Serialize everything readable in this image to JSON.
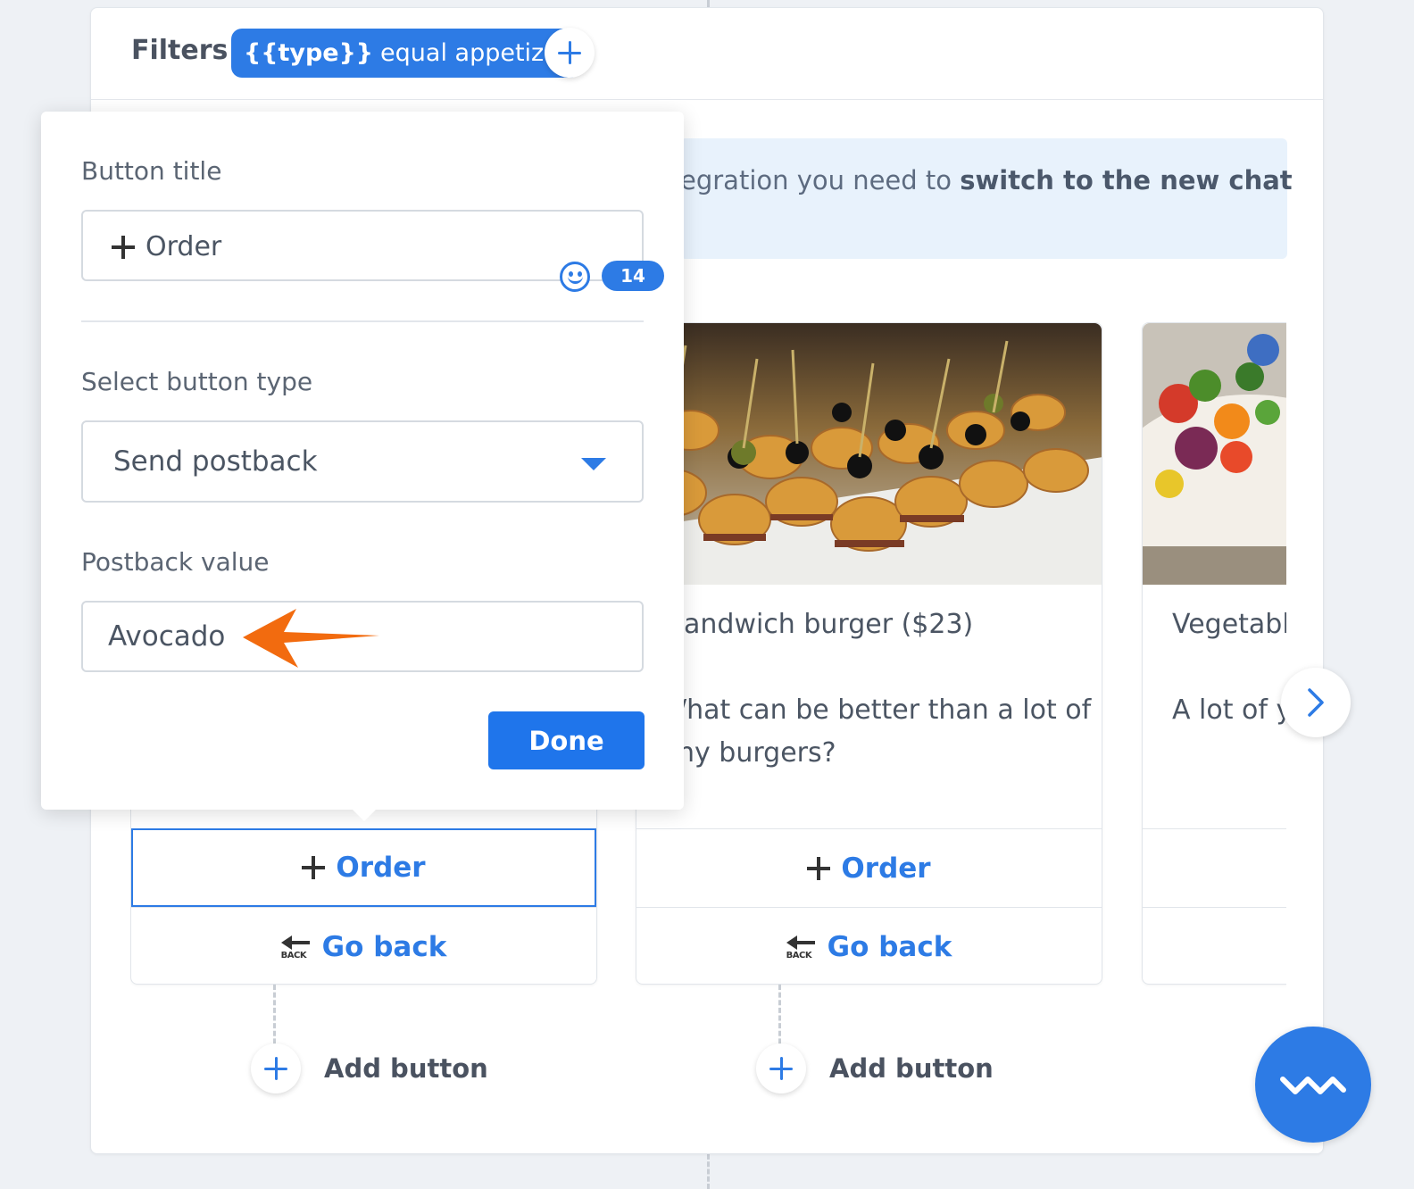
{
  "filters": {
    "label": "Filters",
    "chip_var": "{{type}}",
    "chip_text": "equal appetizer"
  },
  "banner": {
    "text_start": "egration you need to ",
    "text_bold": "switch to the new chat"
  },
  "cards": [
    {
      "title": "",
      "description": [],
      "buttons": [
        {
          "label": "Order",
          "icon": "plus-icon"
        },
        {
          "label": "Go back",
          "icon": "back-icon"
        }
      ],
      "add_button_label": "Add button"
    },
    {
      "title": "andwich burger ($23)",
      "description": [
        "/hat can be better than a lot of",
        "ny burgers?"
      ],
      "buttons": [
        {
          "label": "Order",
          "icon": "plus-icon"
        },
        {
          "label": "Go back",
          "icon": "back-icon"
        }
      ],
      "add_button_label": "Add button"
    },
    {
      "title": "Vegetabl",
      "description": [
        "A lot of y"
      ],
      "buttons": [],
      "add_button_label": ""
    }
  ],
  "back_icon_text": "BACK",
  "editor": {
    "title_label": "Button title",
    "title_value": "Order",
    "char_count": "14",
    "type_label": "Select button type",
    "type_value": "Send postback",
    "postback_label": "Postback value",
    "postback_value": "Avocado",
    "done_label": "Done"
  },
  "colors": {
    "accent": "#2d7be5",
    "annotation_arrow": "#f26b0f",
    "banner_bg": "#e8f2fc"
  }
}
